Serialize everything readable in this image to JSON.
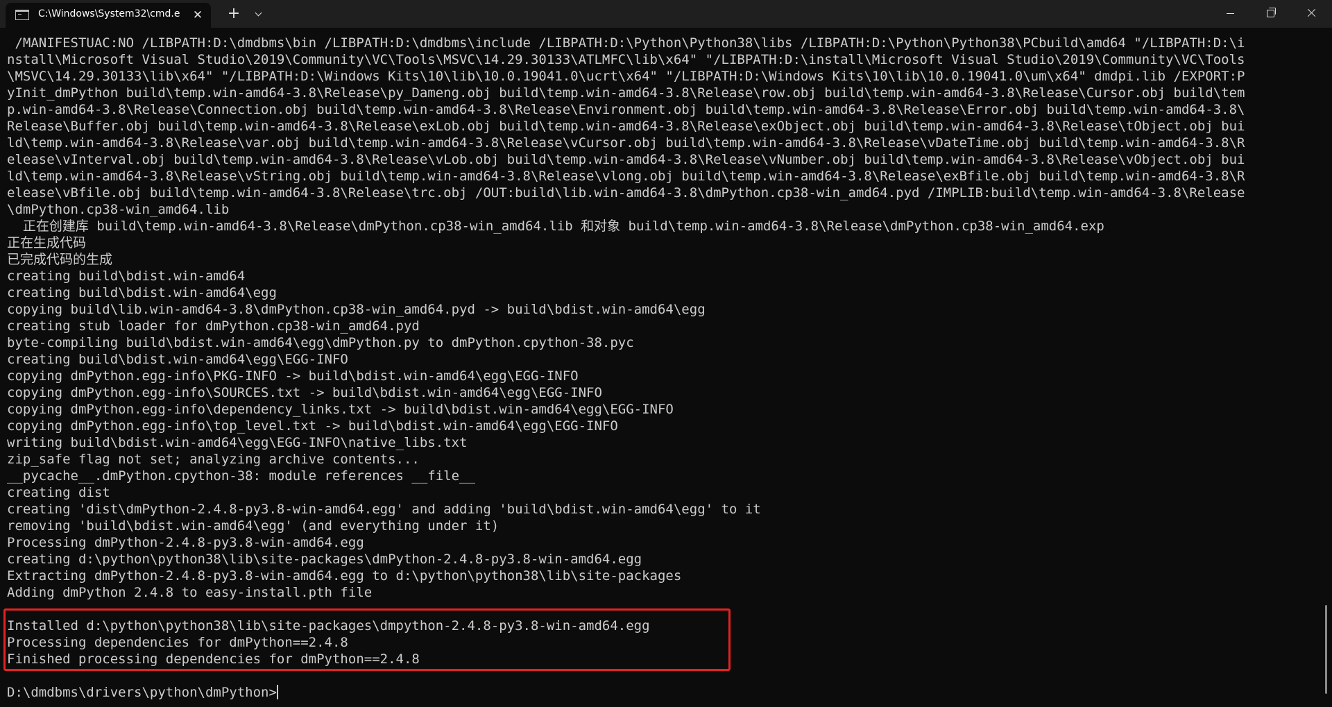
{
  "window": {
    "tab_title": "C:\\Windows\\System32\\cmd.e",
    "close_tab_glyph": "✕",
    "new_tab_glyph": "+"
  },
  "icons": {
    "tab": "terminal-icon",
    "close_tab": "close-icon",
    "new_tab": "plus-icon",
    "dropdown": "chevron-down-icon",
    "minimize": "minimize-icon",
    "restore": "restore-icon",
    "close_window": "close-icon"
  },
  "colors": {
    "background": "#0c0c0c",
    "text": "#cccccc",
    "titlebar": "#1f1f1f",
    "highlight_border": "#e52222"
  },
  "terminal": {
    "lines": [
      " /MANIFESTUAC:NO /LIBPATH:D:\\dmdbms\\bin /LIBPATH:D:\\dmdbms\\include /LIBPATH:D:\\Python\\Python38\\libs /LIBPATH:D:\\Python\\Python38\\PCbuild\\amd64 \"/LIBPATH:D:\\i",
      "nstall\\Microsoft Visual Studio\\2019\\Community\\VC\\Tools\\MSVC\\14.29.30133\\ATLMFC\\lib\\x64\" \"/LIBPATH:D:\\install\\Microsoft Visual Studio\\2019\\Community\\VC\\Tools",
      "\\MSVC\\14.29.30133\\lib\\x64\" \"/LIBPATH:D:\\Windows Kits\\10\\lib\\10.0.19041.0\\ucrt\\x64\" \"/LIBPATH:D:\\Windows Kits\\10\\lib\\10.0.19041.0\\um\\x64\" dmdpi.lib /EXPORT:P",
      "yInit_dmPython build\\temp.win-amd64-3.8\\Release\\py_Dameng.obj build\\temp.win-amd64-3.8\\Release\\row.obj build\\temp.win-amd64-3.8\\Release\\Cursor.obj build\\tem",
      "p.win-amd64-3.8\\Release\\Connection.obj build\\temp.win-amd64-3.8\\Release\\Environment.obj build\\temp.win-amd64-3.8\\Release\\Error.obj build\\temp.win-amd64-3.8\\",
      "Release\\Buffer.obj build\\temp.win-amd64-3.8\\Release\\exLob.obj build\\temp.win-amd64-3.8\\Release\\exObject.obj build\\temp.win-amd64-3.8\\Release\\tObject.obj bui",
      "ld\\temp.win-amd64-3.8\\Release\\var.obj build\\temp.win-amd64-3.8\\Release\\vCursor.obj build\\temp.win-amd64-3.8\\Release\\vDateTime.obj build\\temp.win-amd64-3.8\\R",
      "elease\\vInterval.obj build\\temp.win-amd64-3.8\\Release\\vLob.obj build\\temp.win-amd64-3.8\\Release\\vNumber.obj build\\temp.win-amd64-3.8\\Release\\vObject.obj bui",
      "ld\\temp.win-amd64-3.8\\Release\\vString.obj build\\temp.win-amd64-3.8\\Release\\vlong.obj build\\temp.win-amd64-3.8\\Release\\exBfile.obj build\\temp.win-amd64-3.8\\R",
      "elease\\vBfile.obj build\\temp.win-amd64-3.8\\Release\\trc.obj /OUT:build\\lib.win-amd64-3.8\\dmPython.cp38-win_amd64.pyd /IMPLIB:build\\temp.win-amd64-3.8\\Release",
      "\\dmPython.cp38-win_amd64.lib",
      "  正在创建库 build\\temp.win-amd64-3.8\\Release\\dmPython.cp38-win_amd64.lib 和对象 build\\temp.win-amd64-3.8\\Release\\dmPython.cp38-win_amd64.exp",
      "正在生成代码",
      "已完成代码的生成",
      "creating build\\bdist.win-amd64",
      "creating build\\bdist.win-amd64\\egg",
      "copying build\\lib.win-amd64-3.8\\dmPython.cp38-win_amd64.pyd -> build\\bdist.win-amd64\\egg",
      "creating stub loader for dmPython.cp38-win_amd64.pyd",
      "byte-compiling build\\bdist.win-amd64\\egg\\dmPython.py to dmPython.cpython-38.pyc",
      "creating build\\bdist.win-amd64\\egg\\EGG-INFO",
      "copying dmPython.egg-info\\PKG-INFO -> build\\bdist.win-amd64\\egg\\EGG-INFO",
      "copying dmPython.egg-info\\SOURCES.txt -> build\\bdist.win-amd64\\egg\\EGG-INFO",
      "copying dmPython.egg-info\\dependency_links.txt -> build\\bdist.win-amd64\\egg\\EGG-INFO",
      "copying dmPython.egg-info\\top_level.txt -> build\\bdist.win-amd64\\egg\\EGG-INFO",
      "writing build\\bdist.win-amd64\\egg\\EGG-INFO\\native_libs.txt",
      "zip_safe flag not set; analyzing archive contents...",
      "__pycache__.dmPython.cpython-38: module references __file__",
      "creating dist",
      "creating 'dist\\dmPython-2.4.8-py3.8-win-amd64.egg' and adding 'build\\bdist.win-amd64\\egg' to it",
      "removing 'build\\bdist.win-amd64\\egg' (and everything under it)",
      "Processing dmPython-2.4.8-py3.8-win-amd64.egg",
      "creating d:\\python\\python38\\lib\\site-packages\\dmPython-2.4.8-py3.8-win-amd64.egg",
      "Extracting dmPython-2.4.8-py3.8-win-amd64.egg to d:\\python\\python38\\lib\\site-packages",
      "Adding dmPython 2.4.8 to easy-install.pth file",
      "",
      "Installed d:\\python\\python38\\lib\\site-packages\\dmpython-2.4.8-py3.8-win-amd64.egg",
      "Processing dependencies for dmPython==2.4.8",
      "Finished processing dependencies for dmPython==2.4.8",
      ""
    ],
    "prompt": "D:\\dmdbms\\drivers\\python\\dmPython>"
  }
}
